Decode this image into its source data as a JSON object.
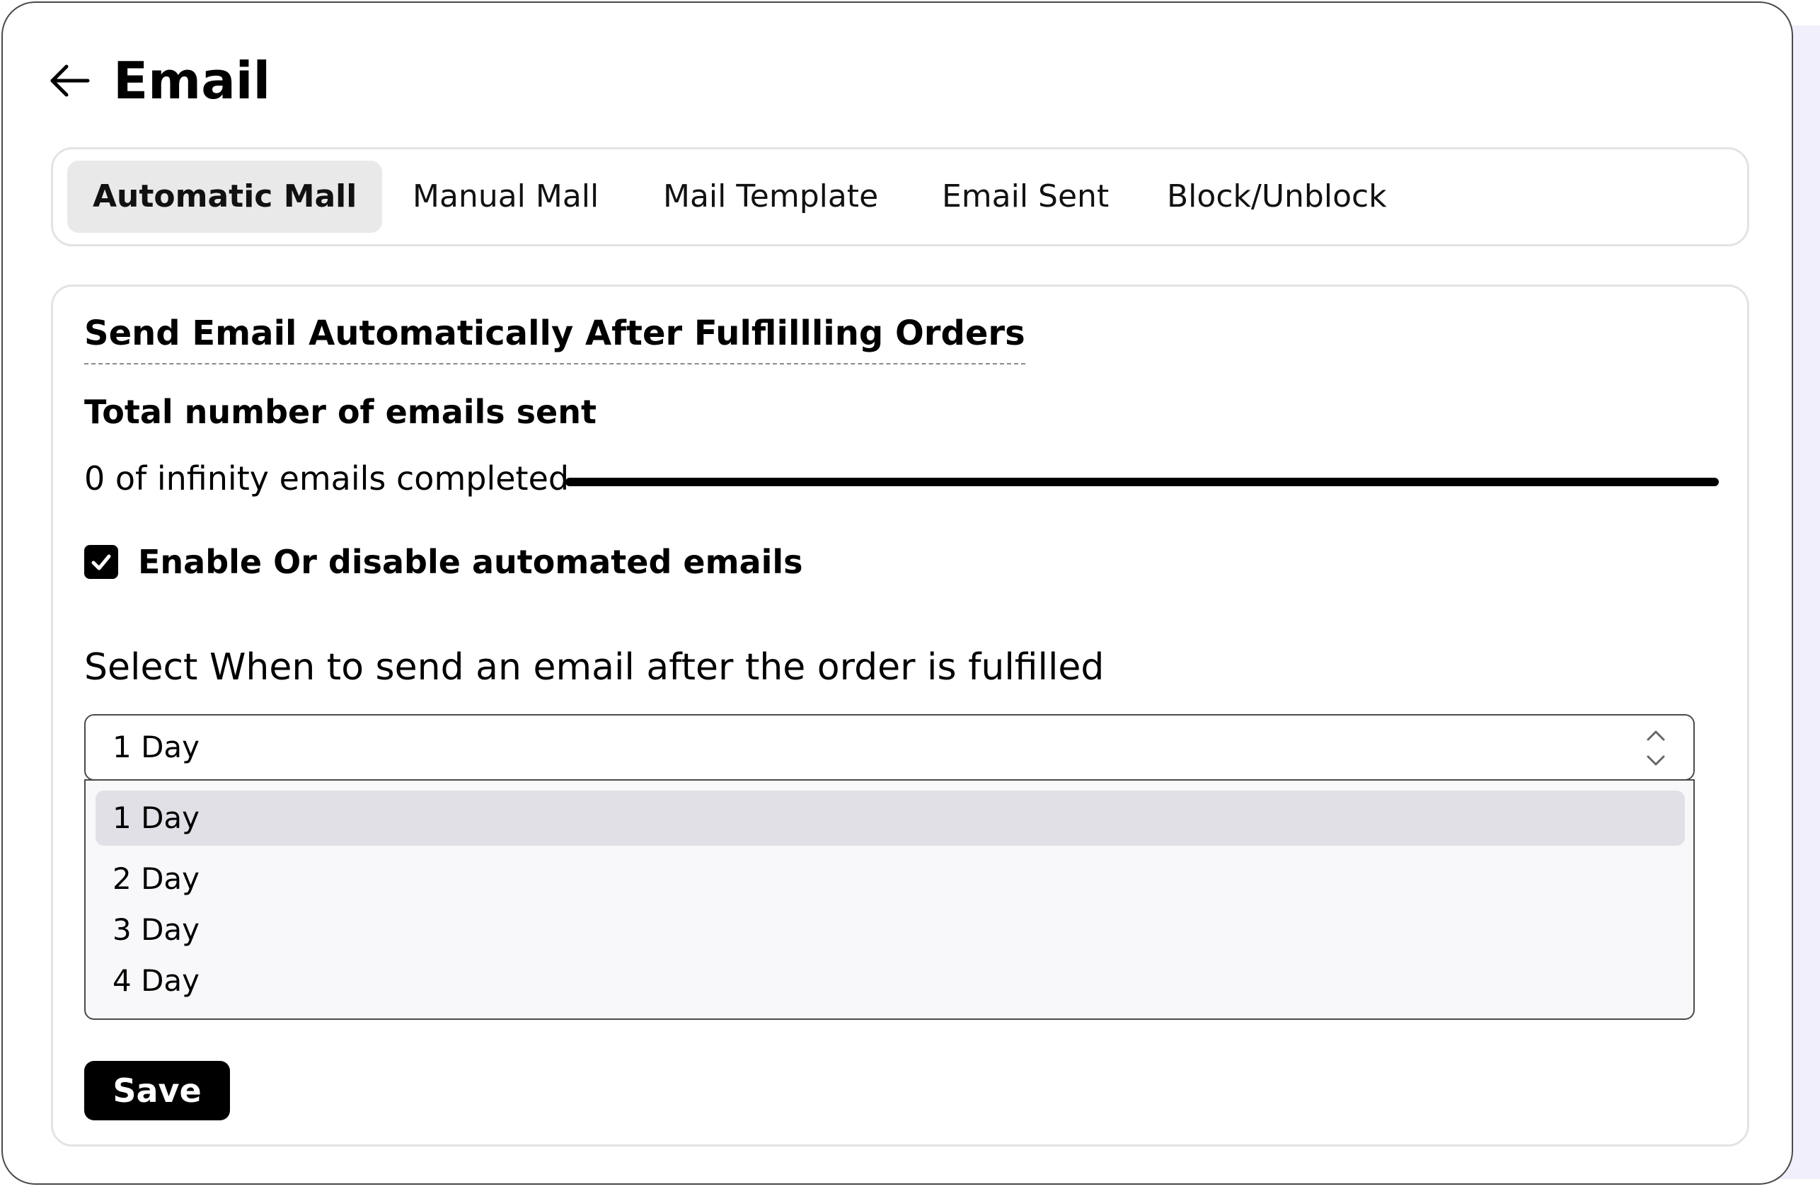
{
  "header": {
    "title": "Email",
    "back_icon": "arrow-left-icon"
  },
  "tabs": [
    {
      "label": "Automatic Mall",
      "active": true
    },
    {
      "label": "Manual Mall",
      "active": false
    },
    {
      "label": "Mail Template",
      "active": false
    },
    {
      "label": "Email Sent",
      "active": false
    },
    {
      "label": "Block/Unblock",
      "active": false
    }
  ],
  "panel": {
    "section_title": "Send Email Automatically After Fulflillling Orders",
    "stat_label": "Total number of emails sent",
    "progress_text": "0 of infinity emails completed",
    "checkbox": {
      "label": "Enable Or disable automated emails",
      "checked": true
    },
    "select_prompt": "Select When to send an email after the order is fulfilled",
    "select": {
      "value": "1 Day",
      "options": [
        "1 Day",
        "2 Day",
        "3 Day",
        "4 Day"
      ],
      "highlighted_index": 0
    },
    "save_label": "Save"
  },
  "colors": {
    "primary": "#000000",
    "border": "#e3e3e3",
    "tab_active_bg": "#e9e9e9",
    "option_highlight": "#e1e0e6",
    "dropdown_bg": "#f8f8fa",
    "backdrop": "#f1effc"
  }
}
